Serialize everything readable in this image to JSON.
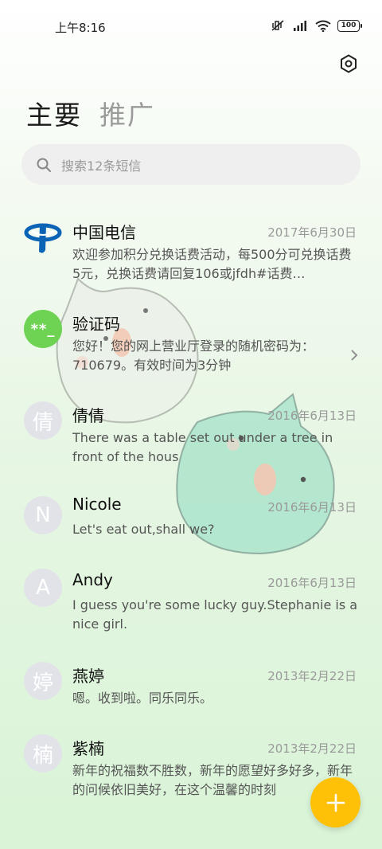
{
  "status_bar": {
    "time": "上午8:16",
    "battery": "100"
  },
  "tabs": [
    {
      "label": "主要",
      "active": true
    },
    {
      "label": "推广",
      "active": false
    }
  ],
  "search": {
    "placeholder": "搜索12条短信"
  },
  "conversations": [
    {
      "avatar": "",
      "avatar_type": "logo",
      "name": "中国电信",
      "date": "2017年6月30日",
      "preview": "欢迎参加积分兑换话费活动，每500分可兑换话费5元，兑换话费请回复106或jfdh#话费…"
    },
    {
      "avatar": "**_",
      "avatar_type": "green",
      "name": "验证码",
      "date": "",
      "preview": "您好！您的网上营业厅登录的随机密码为：710679。有效时间为3分钟"
    },
    {
      "avatar": "倩",
      "avatar_type": "gray",
      "name": "倩倩",
      "date": "2016年6月13日",
      "preview": "There was a table set out under a tree in front of the hous"
    },
    {
      "avatar": "N",
      "avatar_type": "gray",
      "name": "Nicole",
      "date": "2016年6月13日",
      "preview": "Let's eat out,shall we?"
    },
    {
      "avatar": "A",
      "avatar_type": "gray",
      "name": "Andy",
      "date": "2016年6月13日",
      "preview": "I guess you're some lucky guy.Stephanie is a nice girl."
    },
    {
      "avatar": "婷",
      "avatar_type": "gray",
      "name": "燕婷",
      "date": "2013年2月22日",
      "preview": "嗯。收到啦。同乐同乐。"
    },
    {
      "avatar": "楠",
      "avatar_type": "gray",
      "name": "紫楠",
      "date": "2013年2月22日",
      "preview": "新年的祝福数不胜数，新年的愿望好多好多，新年的问候依旧美好，在这个温馨的时刻"
    }
  ],
  "colors": {
    "fab": "#ffc107",
    "green_avatar": "#6ed353",
    "telecom_blue": "#0b63b5"
  },
  "icons": {
    "settings": "settings-icon",
    "search": "search-icon",
    "fab": "plus-icon"
  }
}
